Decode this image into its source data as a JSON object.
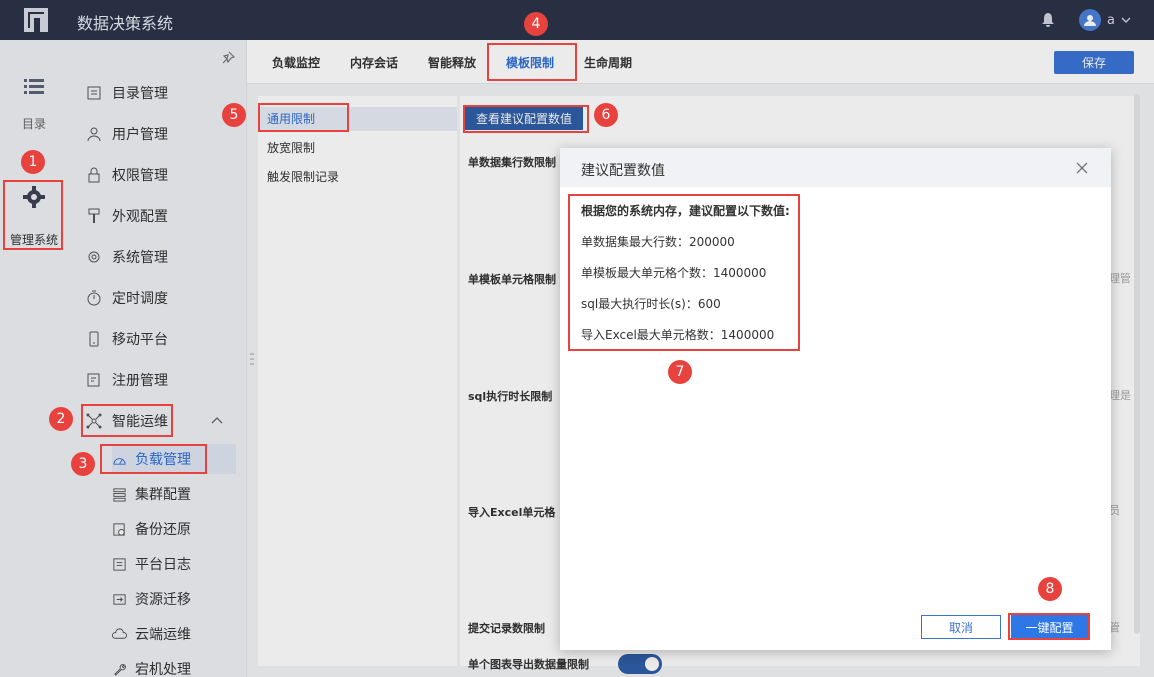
{
  "header": {
    "app_title": "数据决策系统",
    "user_name": "a"
  },
  "rail": {
    "catalog_label": "目录",
    "admin_label": "管理系统"
  },
  "sidebar": {
    "items": [
      {
        "label": "目录管理",
        "icon": "folder-list-icon"
      },
      {
        "label": "用户管理",
        "icon": "user-icon"
      },
      {
        "label": "权限管理",
        "icon": "lock-icon"
      },
      {
        "label": "外观配置",
        "icon": "brush-icon"
      },
      {
        "label": "系统管理",
        "icon": "gear-icon"
      },
      {
        "label": "定时调度",
        "icon": "stopwatch-icon"
      },
      {
        "label": "移动平台",
        "icon": "mobile-icon"
      },
      {
        "label": "注册管理",
        "icon": "register-icon"
      },
      {
        "label": "智能运维",
        "icon": "network-icon"
      }
    ],
    "sub_items": [
      {
        "label": "负载管理",
        "icon": "load-icon"
      },
      {
        "label": "集群配置",
        "icon": "cluster-icon"
      },
      {
        "label": "备份还原",
        "icon": "backup-icon"
      },
      {
        "label": "平台日志",
        "icon": "log-icon"
      },
      {
        "label": "资源迁移",
        "icon": "migrate-icon"
      },
      {
        "label": "云端运维",
        "icon": "cloud-icon"
      },
      {
        "label": "宕机处理",
        "icon": "wrench-icon"
      }
    ]
  },
  "tabs": [
    "负载监控",
    "内存会话",
    "智能释放",
    "模板限制",
    "生命周期"
  ],
  "active_tab": "模板限制",
  "toolbar": {
    "save_label": "保存"
  },
  "left_menu": [
    "通用限制",
    "放宽限制",
    "触发限制记录"
  ],
  "config": {
    "view_button": "查看建议配置数值",
    "labels": [
      "单数据集行数限制",
      "单模板单元格限制",
      "sql执行时长限制",
      "导入Excel单元格",
      "提交记录数限制",
      "单个图表导出数据量限制"
    ],
    "edge_texts": [
      "理管",
      "理是",
      "员",
      "管"
    ],
    "export_toggle_on": true
  },
  "dialog": {
    "title": "建议配置数值",
    "intro": "根据您的系统内存，建议配置以下数值:",
    "lines": [
      "单数据集最大行数：200000",
      "单模板最大单元格个数：1400000",
      "sql最大执行时长(s)：600",
      "导入Excel最大单元格数：1400000"
    ],
    "cancel_label": "取消",
    "apply_label": "一键配置"
  },
  "markers": [
    "1",
    "2",
    "3",
    "4",
    "5",
    "6",
    "7",
    "8"
  ],
  "colors": {
    "accent": "#2f6fd6",
    "topbar": "#2c3448",
    "annotation": "#e8423e"
  }
}
